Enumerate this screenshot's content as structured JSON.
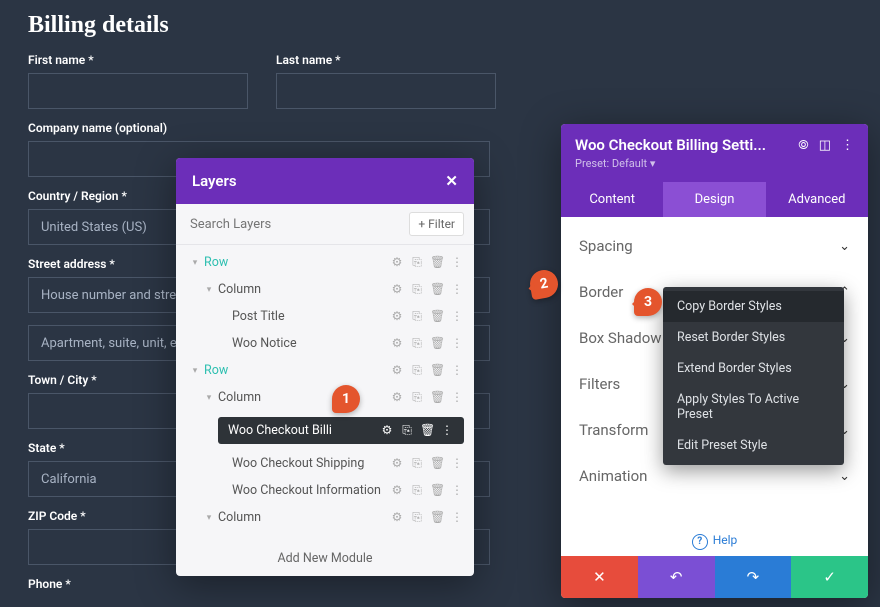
{
  "heading": "Billing details",
  "fields": {
    "first_name": "First name *",
    "last_name": "Last name *",
    "company": "Company name (optional)",
    "country": "Country / Region *",
    "country_val": "United States (US)",
    "street": "Street address *",
    "street1_ph": "House number and street",
    "street2_ph": "Apartment, suite, unit, etc.",
    "city": "Town / City *",
    "state": "State *",
    "state_val": "California",
    "zip": "ZIP Code *",
    "phone": "Phone *"
  },
  "layers": {
    "title": "Layers",
    "search_ph": "Search Layers",
    "filter": "+ Filter",
    "items": [
      {
        "lbl": "Row",
        "lv": 0,
        "teal": true,
        "chev": "▾"
      },
      {
        "lbl": "Column",
        "lv": 1,
        "chev": "▾"
      },
      {
        "lbl": "Post Title",
        "lv": 2
      },
      {
        "lbl": "Woo Notice",
        "lv": 2
      },
      {
        "lbl": "Row",
        "lv": 0,
        "teal": true,
        "chev": "▾"
      },
      {
        "lbl": "Column",
        "lv": 1,
        "chev": "▾"
      },
      {
        "lbl": "Woo Checkout Billi",
        "lv": 2,
        "hl": true
      },
      {
        "lbl": "Woo Checkout Shipping",
        "lv": 2
      },
      {
        "lbl": "Woo Checkout Information",
        "lv": 2
      },
      {
        "lbl": "Column",
        "lv": 1,
        "chev": "▾"
      }
    ],
    "addnew": "Add New Module"
  },
  "settings": {
    "title": "Woo Checkout Billing Setti...",
    "preset": "Preset: Default ▾",
    "tabs": [
      "Content",
      "Design",
      "Advanced"
    ],
    "active_tab": 1,
    "sections": [
      "Spacing",
      "Border",
      "Box Shadow",
      "Filters",
      "Transform",
      "Animation"
    ],
    "help": "Help"
  },
  "ctx": {
    "items": [
      "Copy Border Styles",
      "Reset Border Styles",
      "Extend Border Styles",
      "Apply Styles To Active Preset",
      "Edit Preset Style"
    ],
    "sel": 0
  },
  "badges": {
    "b1": "1",
    "b2": "2",
    "b3": "3"
  }
}
